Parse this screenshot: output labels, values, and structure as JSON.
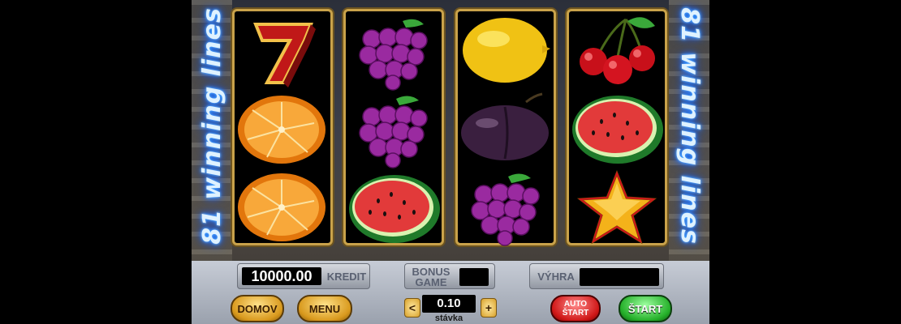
{
  "neon": {
    "left_text": "81 winning lines",
    "right_text": "81 winning lines"
  },
  "reels": [
    [
      "seven-symbol",
      "orange-symbol",
      "orange-symbol"
    ],
    [
      "grapes-symbol",
      "grapes-symbol",
      "watermelon-symbol"
    ],
    [
      "lemon-symbol",
      "plum-symbol",
      "grapes-symbol"
    ],
    [
      "cherries-symbol",
      "watermelon-symbol",
      "star-symbol"
    ]
  ],
  "panel": {
    "credit_value": "10000.00",
    "credit_label": "KREDIT",
    "bonus_label_line1": "BONUS",
    "bonus_label_line2": "GAME",
    "bonus_value": "",
    "win_label": "VÝHRA",
    "win_value": "",
    "bet_value": "0.10",
    "bet_label": "stávka",
    "bet_decrease": "<",
    "bet_increase": "+",
    "home_button": "DOMOV",
    "menu_button": "MENU",
    "auto_button_line1": "AUTO",
    "auto_button_line2": "ŠTART",
    "start_button": "ŠTART"
  },
  "colors": {
    "reel_frame": "#c9a24a",
    "neon": "#3fa8ff",
    "auto_button": "#d01818",
    "start_button": "#25b02a",
    "gold_button": "#d99a1e"
  }
}
